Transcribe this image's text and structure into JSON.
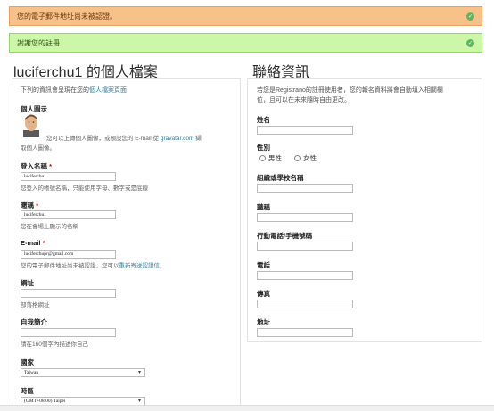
{
  "alerts": {
    "email_unverified": "您的電子郵件地址尚未被認證。",
    "thanks": "謝謝您的註冊"
  },
  "icons": {
    "alert_check": "check-circle-icon",
    "avatar": "default-avatar-icon",
    "dropdown": "chevron-down-icon"
  },
  "colors": {
    "warning_bg": "#f9c18a",
    "success_bg": "#cdf7a8",
    "link": "#2f7f9f",
    "required": "#cc0000"
  },
  "profile": {
    "title": "luciferchu1 的個人檔案",
    "intro_prefix": "下列的資訊會呈現在您的",
    "intro_link": "個人檔案頁面",
    "photo": {
      "label": "個人圖示",
      "text_a": "您可以上傳個人圖像，或預設您的 E-mail 從",
      "link": "gravatar.com",
      "text_b": "擷",
      "text_c": "取個人圖像。"
    },
    "username": {
      "label": "登入名稱",
      "required": "*",
      "value": "luciferchu1",
      "help": "您登入的帳號名稱，只能使用字母、數字或是底線"
    },
    "nickname": {
      "label": "暱稱",
      "required": "*",
      "value": "luciferchu1",
      "help": "您在會場上顯示的名稱"
    },
    "email": {
      "label": "E-mail",
      "required": "*",
      "value": "luciferchupr@gmail.com",
      "help_prefix": "您的電子郵件地址尚未被認證，您可以",
      "help_link": "重新寄送認證信",
      "help_suffix": "。"
    },
    "website": {
      "label": "網址",
      "value": "",
      "help": "部落格網址"
    },
    "bio": {
      "label": "自我簡介",
      "value": "",
      "help": "請在160個字內描述你自己"
    },
    "country": {
      "label": "國家",
      "value": "Taiwan"
    },
    "timezone": {
      "label": "時區",
      "value": "(GMT+08:00) Taipei"
    }
  },
  "contact": {
    "title": "聯絡資訊",
    "intro_line1": "若您是Registrano的註冊使用者，您的報名資料將會自動填入相關欄",
    "intro_line2": "位，且可以在未來隨時自由更改。",
    "name_label": "姓名",
    "gender_label": "性別",
    "gender_male": "男性",
    "gender_female": "女性",
    "org_label": "組織或學校名稱",
    "job_label": "職稱",
    "mobile_label": "行動電話/手機號碼",
    "phone_label": "電話",
    "fax_label": "傳真",
    "address_label": "地址"
  }
}
